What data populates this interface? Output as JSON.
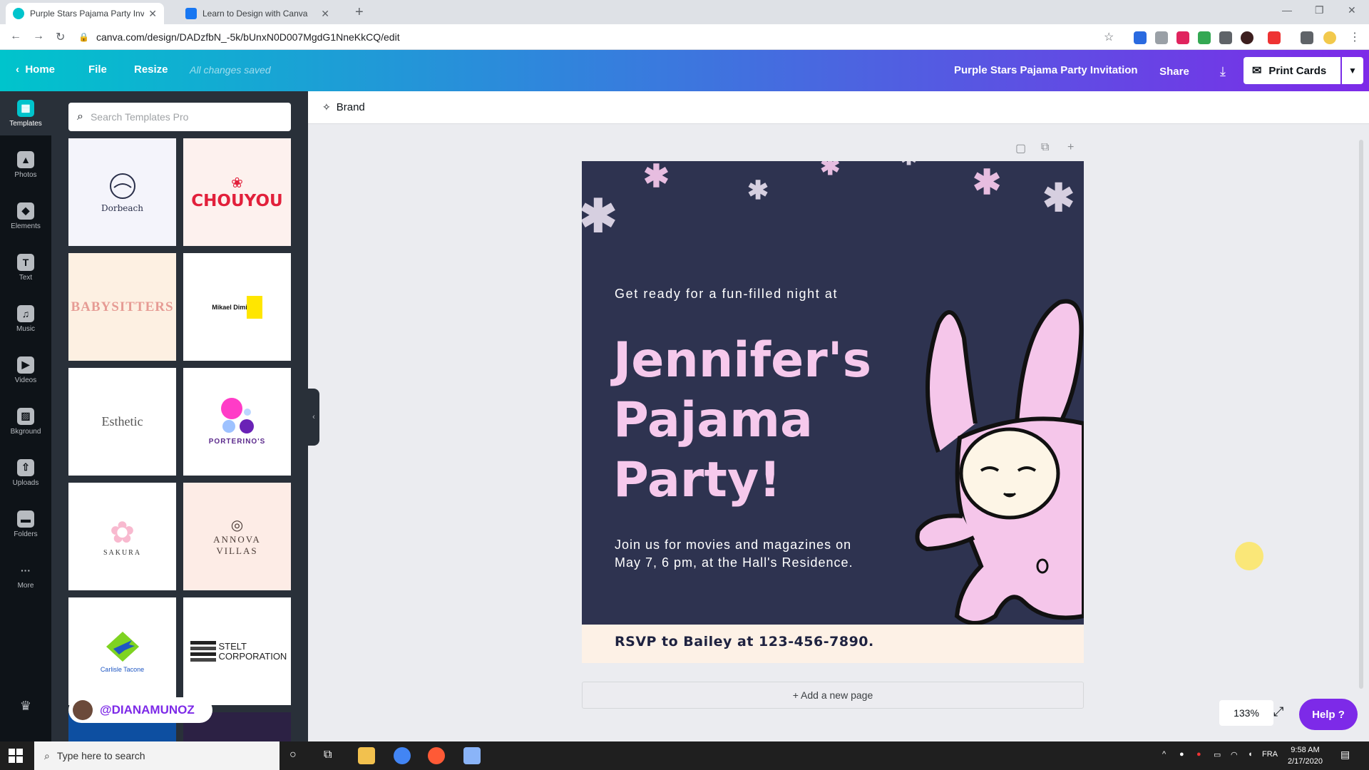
{
  "browser": {
    "tabs": [
      {
        "title": "Purple Stars Pajama Party Invitati",
        "active": true
      },
      {
        "title": "Learn to Design with Canva",
        "active": false
      }
    ],
    "url": "canva.com/design/DADzfbN_-5k/bUnxN0D007MgdG1NneKkCQ/edit"
  },
  "header": {
    "home": "Home",
    "file": "File",
    "resize": "Resize",
    "saved_status": "All changes saved",
    "doc_title": "Purple Stars Pajama Party Invitation",
    "share": "Share",
    "print_cards": "Print Cards"
  },
  "rail": {
    "items": [
      {
        "label": "Templates",
        "glyph": "▦"
      },
      {
        "label": "Photos",
        "glyph": "▲"
      },
      {
        "label": "Elements",
        "glyph": "◆"
      },
      {
        "label": "Text",
        "glyph": "T"
      },
      {
        "label": "Music",
        "glyph": "♫"
      },
      {
        "label": "Videos",
        "glyph": "▶"
      },
      {
        "label": "Bkground",
        "glyph": "▨"
      },
      {
        "label": "Uploads",
        "glyph": "⇧"
      },
      {
        "label": "Folders",
        "glyph": "▬"
      },
      {
        "label": "More",
        "glyph": "···"
      }
    ]
  },
  "panel": {
    "search_placeholder": "Search Templates Pro",
    "templates": [
      {
        "name": "Dorbeach",
        "bg": "#f4f4fb",
        "color": "#2a2f4a"
      },
      {
        "name": "CHOUYOU",
        "bg": "#fdf1ee",
        "color": "#e2203b"
      },
      {
        "name": "BABYSITTERS",
        "bg": "#fdf0e2",
        "color": "#e69b94"
      },
      {
        "name": "Mikael Dimitri",
        "bg": "#ffffff",
        "color": "#111111"
      },
      {
        "name": "Esthetic",
        "bg": "#ffffff",
        "color": "#555555"
      },
      {
        "name": "PORTERINO'S",
        "bg": "#ffffff",
        "color": "#5b2a8c"
      },
      {
        "name": "SAKURA",
        "bg": "#ffffff",
        "color": "#333333"
      },
      {
        "name": "ANNOVA VILLAS",
        "bg": "#fdece6",
        "color": "#4a3b36"
      },
      {
        "name": "Carlisle Tacone",
        "bg": "#ffffff",
        "color": "#1f57c3"
      },
      {
        "name": "STELT CORPORATION",
        "bg": "#ffffff",
        "color": "#222222"
      }
    ],
    "creator_handle": "@DIANAMUNOZ"
  },
  "workspace": {
    "brand": "Brand",
    "design": {
      "intro": "Get ready for a fun-filled night at",
      "headline": [
        "Jennifer's",
        "Pajama",
        "Party!"
      ],
      "details": "Join us for movies and magazines on May 7, 6 pm, at the Hall's Residence.",
      "rsvp": "RSVP to Bailey at 123-456-7890.",
      "bg_color": "#2e3350",
      "accent_color": "#f6c9ec"
    },
    "add_page": "+ Add a new page",
    "zoom": "133%",
    "help": "Help ?"
  },
  "taskbar": {
    "search_placeholder": "Type here to search",
    "language": "FRA",
    "time": "9:58 AM",
    "date": "2/17/2020"
  }
}
